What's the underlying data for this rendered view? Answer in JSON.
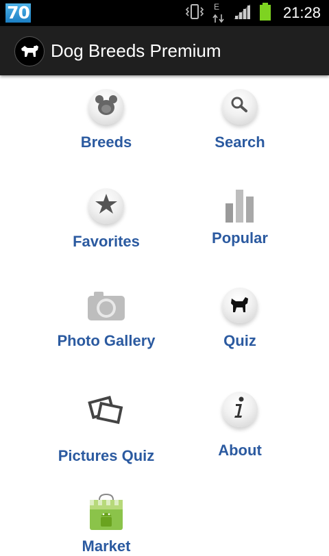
{
  "status_bar": {
    "badge": "70",
    "time": "21:28",
    "network_type": "E",
    "icons": [
      "vibrate-icon",
      "data-arrows-icon",
      "signal-icon",
      "battery-icon"
    ]
  },
  "action_bar": {
    "title": "Dog Breeds Premium",
    "logo_icon": "dog-logo-icon"
  },
  "menu": {
    "breeds": {
      "label": "Breeds",
      "icon": "paw-icon"
    },
    "search": {
      "label": "Search",
      "icon": "magnifier-icon"
    },
    "favorites": {
      "label": "Favorites",
      "icon": "star-icon"
    },
    "popular": {
      "label": "Popular",
      "icon": "bar-chart-icon"
    },
    "photo_gallery": {
      "label": "Photo Gallery",
      "icon": "camera-icon"
    },
    "quiz": {
      "label": "Quiz",
      "icon": "dog-silhouette-icon"
    },
    "pictures_quiz": {
      "label": "Pictures Quiz",
      "icon": "pictures-icon"
    },
    "about": {
      "label": "About",
      "icon": "info-icon"
    },
    "market": {
      "label": "Market",
      "icon": "android-market-icon"
    }
  },
  "colors": {
    "label": "#2b5aa0",
    "action_bar": "#1f1f1f",
    "status_bar": "#000000",
    "battery": "#7ed321"
  }
}
